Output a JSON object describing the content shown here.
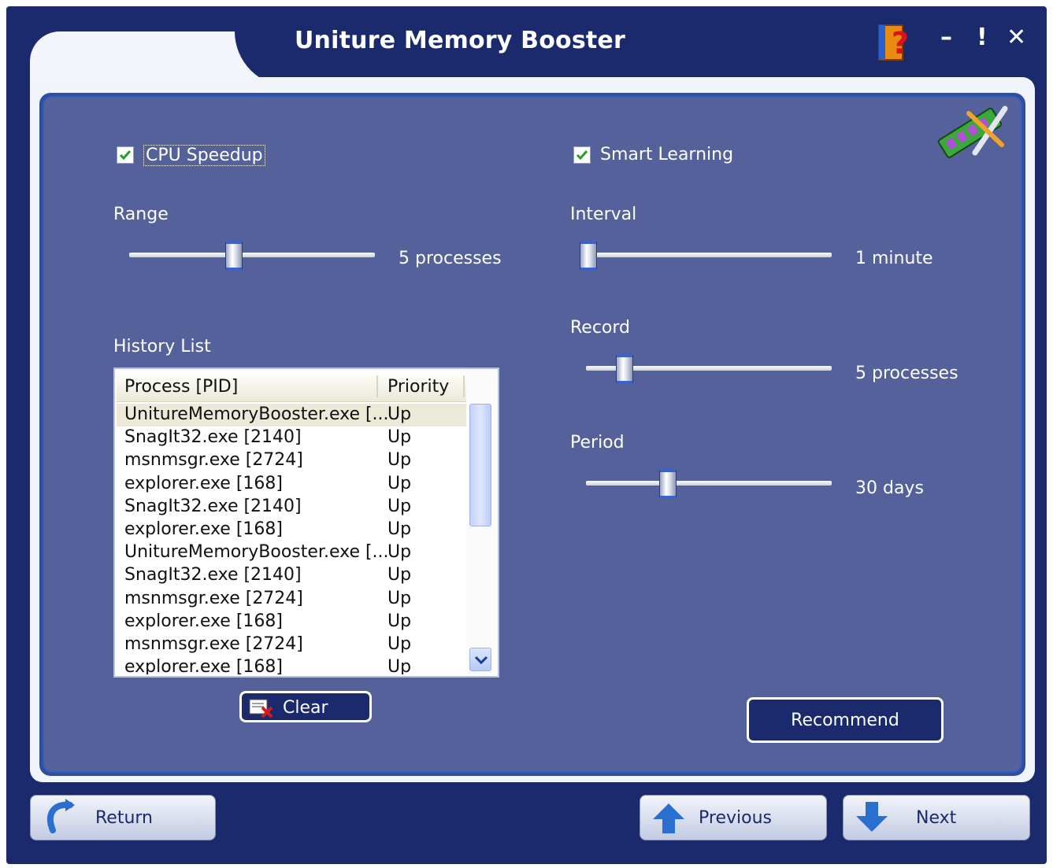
{
  "window": {
    "title": "Uniture Memory Booster",
    "minimize_label": "–",
    "alert_label": "!",
    "close_label": "✕",
    "help_icon": "help-book-icon"
  },
  "cpu": {
    "checkbox_label": "CPU Speedup",
    "checked": true,
    "range_label": "Range",
    "range_value": "5 processes",
    "range_fraction": 0.42
  },
  "smart": {
    "checkbox_label": "Smart Learning",
    "checked": true,
    "interval_label": "Interval",
    "interval_value": "1 minute",
    "interval_fraction": 0.0,
    "record_label": "Record",
    "record_value": "5 processes",
    "record_fraction": 0.13,
    "period_label": "Period",
    "period_value": "30 days",
    "period_fraction": 0.32
  },
  "history": {
    "label": "History List",
    "columns": [
      "Process [PID]",
      "Priority"
    ],
    "rows": [
      {
        "process": "UnitureMemoryBooster.exe [...",
        "priority": "Up"
      },
      {
        "process": "SnagIt32.exe [2140]",
        "priority": "Up"
      },
      {
        "process": "msnmsgr.exe [2724]",
        "priority": "Up"
      },
      {
        "process": "explorer.exe [168]",
        "priority": "Up"
      },
      {
        "process": "SnagIt32.exe [2140]",
        "priority": "Up"
      },
      {
        "process": "explorer.exe [168]",
        "priority": "Up"
      },
      {
        "process": "UnitureMemoryBooster.exe [...",
        "priority": "Up"
      },
      {
        "process": "SnagIt32.exe [2140]",
        "priority": "Up"
      },
      {
        "process": "msnmsgr.exe [2724]",
        "priority": "Up"
      },
      {
        "process": "explorer.exe [168]",
        "priority": "Up"
      },
      {
        "process": "msnmsgr.exe [2724]",
        "priority": "Up"
      },
      {
        "process": "explorer.exe [168]",
        "priority": "Up"
      }
    ],
    "clear_label": "Clear"
  },
  "recommend_label": "Recommend",
  "nav": {
    "return_label": "Return",
    "previous_label": "Previous",
    "next_label": "Next"
  },
  "colors": {
    "window_bg": "#1a2a6c",
    "panel_bg": "#55619a",
    "accent": "#3a62c8"
  }
}
